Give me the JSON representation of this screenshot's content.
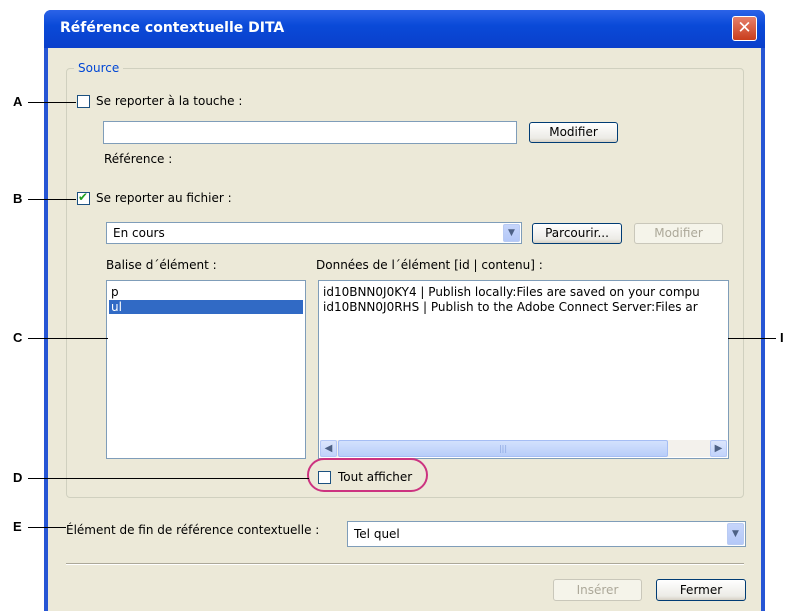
{
  "window": {
    "title": "Référence contextuelle DITA",
    "close_glyph": "✕"
  },
  "source": {
    "legend": "Source",
    "key_checkbox": {
      "label": "Se reporter à la touche :",
      "checked": false
    },
    "key_value": "",
    "modify_button": "Modifier",
    "reference_label": "Référence :",
    "file_checkbox": {
      "label": "Se reporter au fichier :",
      "checked": true
    },
    "file_select_value": "En cours",
    "browse_button": "Parcourir...",
    "modify_button_2": "Modifier",
    "element_tag_label": "Balise d´élément :",
    "element_tags": [
      {
        "label": "p",
        "selected": false
      },
      {
        "label": "ul",
        "selected": true
      }
    ],
    "element_data_label": "Données de l´élément [id | contenu] :",
    "element_data": [
      "id10BNN0J0KY4 | Publish locally:Files are saved on your compu",
      "id10BNN0J0RHS | Publish to the Adobe Connect Server:Files ar"
    ],
    "show_all": {
      "label": "Tout afficher",
      "checked": false
    }
  },
  "end_element": {
    "label": "Élément de fin de référence contextuelle :",
    "value": "Tel quel"
  },
  "footer": {
    "insert_button": "Insérer",
    "close_button": "Fermer"
  },
  "callouts": [
    "A",
    "B",
    "C",
    "D",
    "E",
    "I"
  ],
  "colors": {
    "title_bar": "#0a4ad8",
    "dialog_bg": "#ece9d8",
    "selection": "#316ac5",
    "highlight_ring": "#cc3380",
    "legend_text": "#0046d5"
  },
  "icons": {
    "dropdown": "chevron-down-icon",
    "scroll_left": "arrow-left-icon",
    "scroll_right": "arrow-right-icon",
    "check": "checkmark-icon"
  }
}
